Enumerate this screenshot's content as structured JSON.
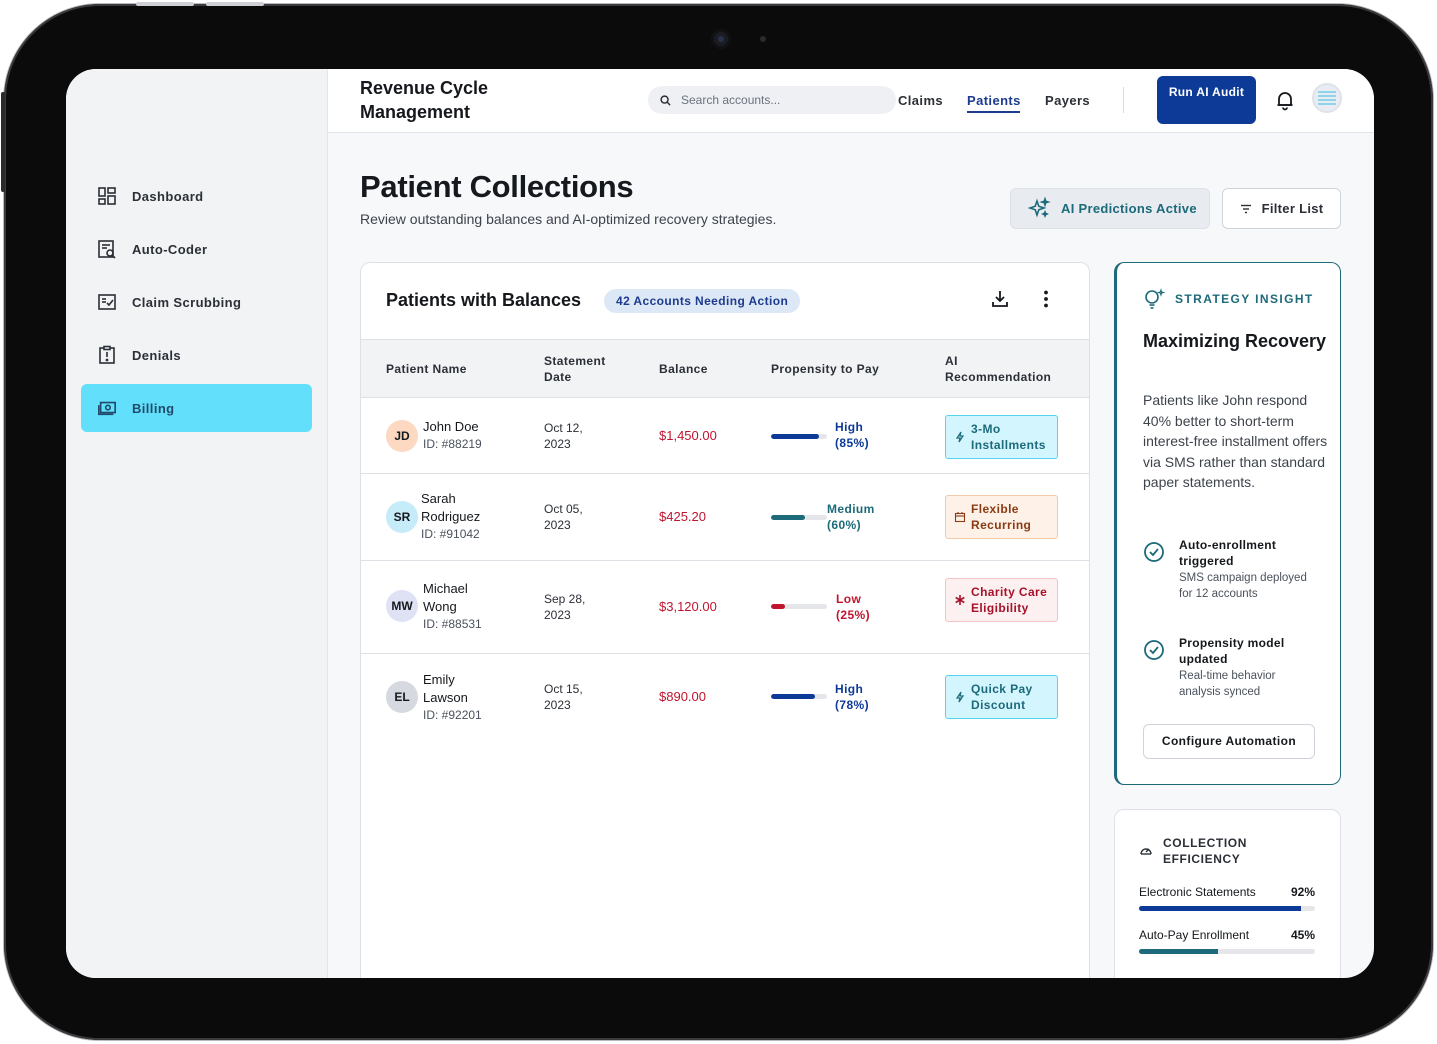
{
  "app": {
    "title": "Revenue Cycle Management"
  },
  "sidebar": {
    "items": [
      {
        "label": "Dashboard",
        "icon": "dashboard-icon"
      },
      {
        "label": "Auto-Coder",
        "icon": "auto-coder-icon"
      },
      {
        "label": "Claim Scrubbing",
        "icon": "claim-scrubbing-icon"
      },
      {
        "label": "Denials",
        "icon": "denials-icon"
      },
      {
        "label": "Billing",
        "icon": "billing-icon",
        "active": true
      }
    ]
  },
  "header": {
    "search": {
      "placeholder": "Search accounts..."
    },
    "nav": [
      {
        "label": "Claims"
      },
      {
        "label": "Patients",
        "active": true
      },
      {
        "label": "Payers"
      }
    ],
    "run_button": "Run AI Audit"
  },
  "page": {
    "title": "Patient Collections",
    "subtitle": "Review outstanding balances and AI-optimized recovery strategies.",
    "ai_chip": "AI Predictions Active",
    "filter_button": "Filter List"
  },
  "table": {
    "title": "Patients with Balances",
    "badge": "42 Accounts Needing Action",
    "columns": [
      "Patient Name",
      "Statement Date",
      "Balance",
      "Propensity to Pay",
      "AI Recommendation"
    ],
    "rows": [
      {
        "initials": "JD",
        "name": "John Doe",
        "id": "ID: #88219",
        "date": "Oct 12, 2023",
        "balance": "$1,450.00",
        "propensity": "High (85%)",
        "propensity_value": 85,
        "recommendation": "3-Mo Installments",
        "rec_style": "cyan"
      },
      {
        "initials": "SR",
        "name": "Sarah Rodriguez",
        "id": "ID: #91042",
        "date": "Oct 05, 2023",
        "balance": "$425.20",
        "propensity": "Medium (60%)",
        "propensity_value": 60,
        "recommendation": "Flexible Recurring",
        "rec_style": "orange"
      },
      {
        "initials": "MW",
        "name": "Michael Wong",
        "id": "ID: #88531",
        "date": "Sep 28, 2023",
        "balance": "$3,120.00",
        "propensity": "Low (25%)",
        "propensity_value": 25,
        "recommendation": "Charity Care Eligibility",
        "rec_style": "red"
      },
      {
        "initials": "EL",
        "name": "Emily Lawson",
        "id": "ID: #92201",
        "date": "Oct 15, 2023",
        "balance": "$890.00",
        "propensity": "High (78%)",
        "propensity_value": 78,
        "recommendation": "Quick Pay Discount",
        "rec_style": "cyan"
      }
    ]
  },
  "insight": {
    "label": "STRATEGY INSIGHT",
    "title": "Maximizing Recovery",
    "body": "Patients like John respond 40% better to short-term interest-free installment offers via SMS rather than standard paper statements.",
    "items": [
      {
        "title": "Auto-enrollment triggered",
        "detail": "SMS campaign deployed for 12 accounts"
      },
      {
        "title": "Propensity model updated",
        "detail": "Real-time behavior analysis synced"
      }
    ],
    "button": "Configure Automation"
  },
  "efficiency": {
    "label": "COLLECTION EFFICIENCY",
    "metrics": [
      {
        "label": "Electronic Statements",
        "pct": "92%",
        "value": 92,
        "color": "#0d3a96"
      },
      {
        "label": "Auto-Pay Enrollment",
        "pct": "45%",
        "value": 45,
        "color": "#1c6a7a"
      }
    ]
  },
  "colors": {
    "primary": "#0d3a96",
    "teal": "#1c6a7a",
    "balance_red": "#c0152f",
    "active_nav": "#62e0fb"
  }
}
